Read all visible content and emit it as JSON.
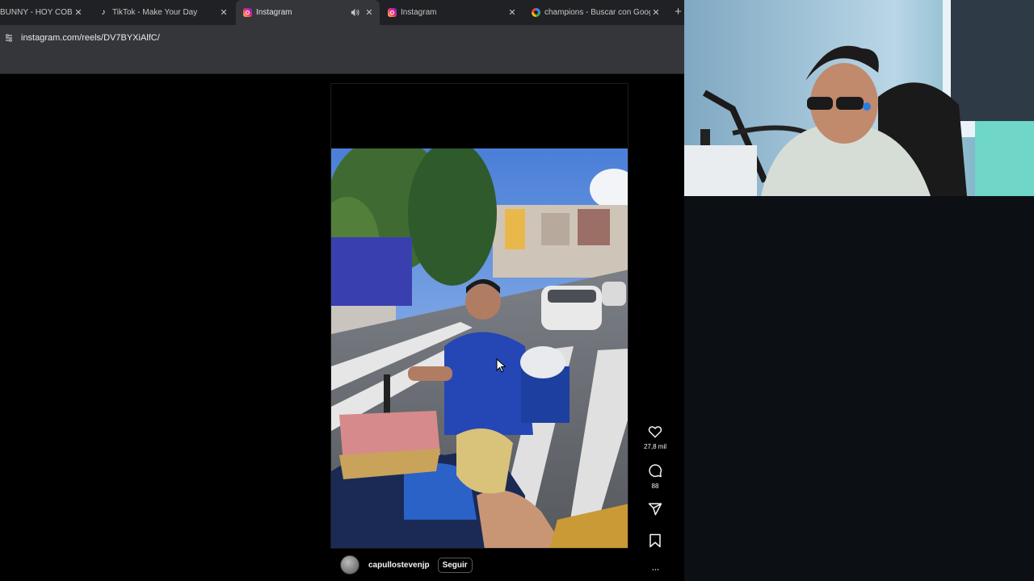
{
  "browser": {
    "tabs": [
      {
        "title": "BUNNY - HOY COBRE",
        "icon": "generic-favicon-icon",
        "active": false,
        "close": "✕"
      },
      {
        "title": "TikTok - Make Your Day",
        "icon": "tiktok-icon",
        "active": false,
        "close": "✕"
      },
      {
        "title": "Instagram",
        "icon": "instagram-icon",
        "active": true,
        "close": "✕"
      },
      {
        "title": "Instagram",
        "icon": "instagram-icon",
        "active": false,
        "close": "✕"
      },
      {
        "title": "champions - Buscar con Google",
        "icon": "google-icon",
        "active": false,
        "close": "✕"
      }
    ],
    "new_tab": "+",
    "url": "instagram.com/reels/DV7BYXiAlfC/"
  },
  "reel": {
    "username": "capullostevenjp",
    "follow_label": "Seguir",
    "likes": "27,8 mil",
    "comments": "88",
    "more": "···"
  },
  "colors": {
    "page_bg": "#000000",
    "side_bg": "#0c1014",
    "chrome_dark": "#202124",
    "chrome_toolbar": "#35363a"
  }
}
